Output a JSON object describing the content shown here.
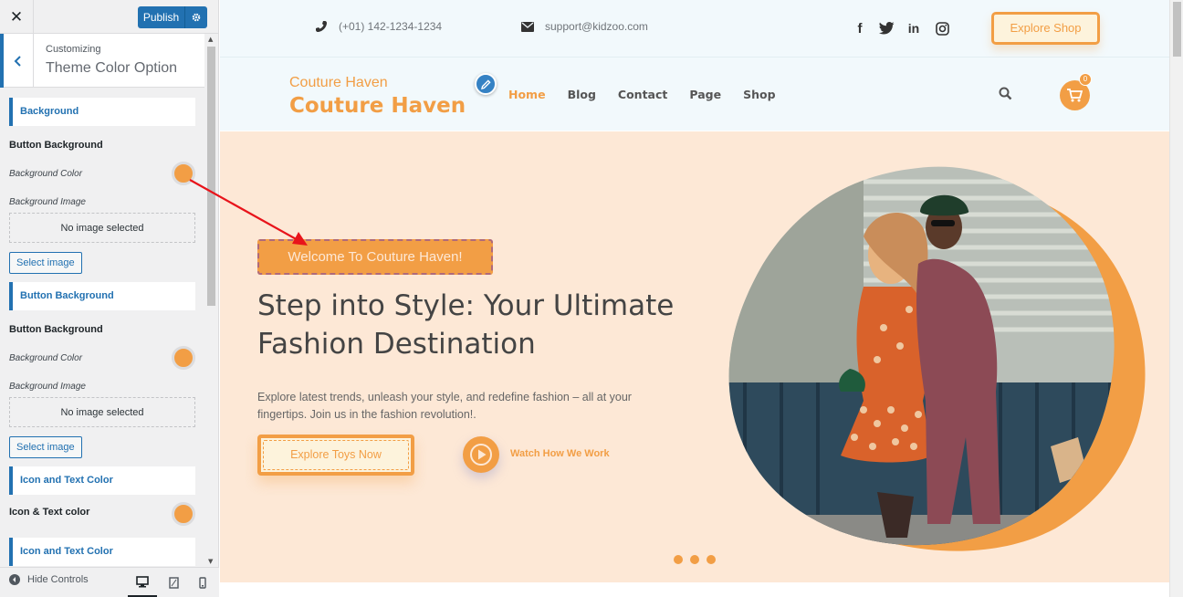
{
  "customizer": {
    "close_label": "✕",
    "publish_label": "Publish",
    "customizing_label": "Customizing",
    "panel_title": "Theme Color Option",
    "sections": [
      {
        "heading": "Background"
      },
      {
        "heading": "Button Background"
      },
      {
        "heading": "Icon and Text Color"
      },
      {
        "heading": "Icon and Text Color"
      }
    ],
    "controls": {
      "button_bg_1": "Button Background",
      "bg_color_label_1": "Background Color",
      "bg_image_label_1": "Background Image",
      "no_image_1": "No image selected",
      "select_image_1": "Select image",
      "button_bg_2": "Button Background",
      "bg_color_label_2": "Background Color",
      "bg_image_label_2": "Background Image",
      "no_image_2": "No image selected",
      "select_image_2": "Select image",
      "icon_text_color": "Icon & Text color"
    },
    "swatch_color": "#f29e45",
    "hide_controls": "Hide Controls"
  },
  "site": {
    "phone": "(+01) 142-1234-1234",
    "email": "support@kidzoo.com",
    "social": {
      "facebook": "f",
      "linkedin": "in"
    },
    "explore_shop": "Explore Shop",
    "logo_small": "Couture Haven",
    "logo_big": "Couture Haven",
    "nav": [
      "Home",
      "Blog",
      "Contact",
      "Page",
      "Shop"
    ],
    "cart_count": "0",
    "hero": {
      "welcome": "Welcome To Couture Haven!",
      "title": "Step into Style: Your Ultimate Fashion Destination",
      "description": "Explore latest trends, unleash your style, and redefine fashion – all at your fingertips. Join us in the fashion revolution!.",
      "cta": "Explore Toys Now",
      "watch": "Watch How We Work"
    },
    "accent_color": "#f29e45",
    "hero_bg": "#fde8d6"
  }
}
